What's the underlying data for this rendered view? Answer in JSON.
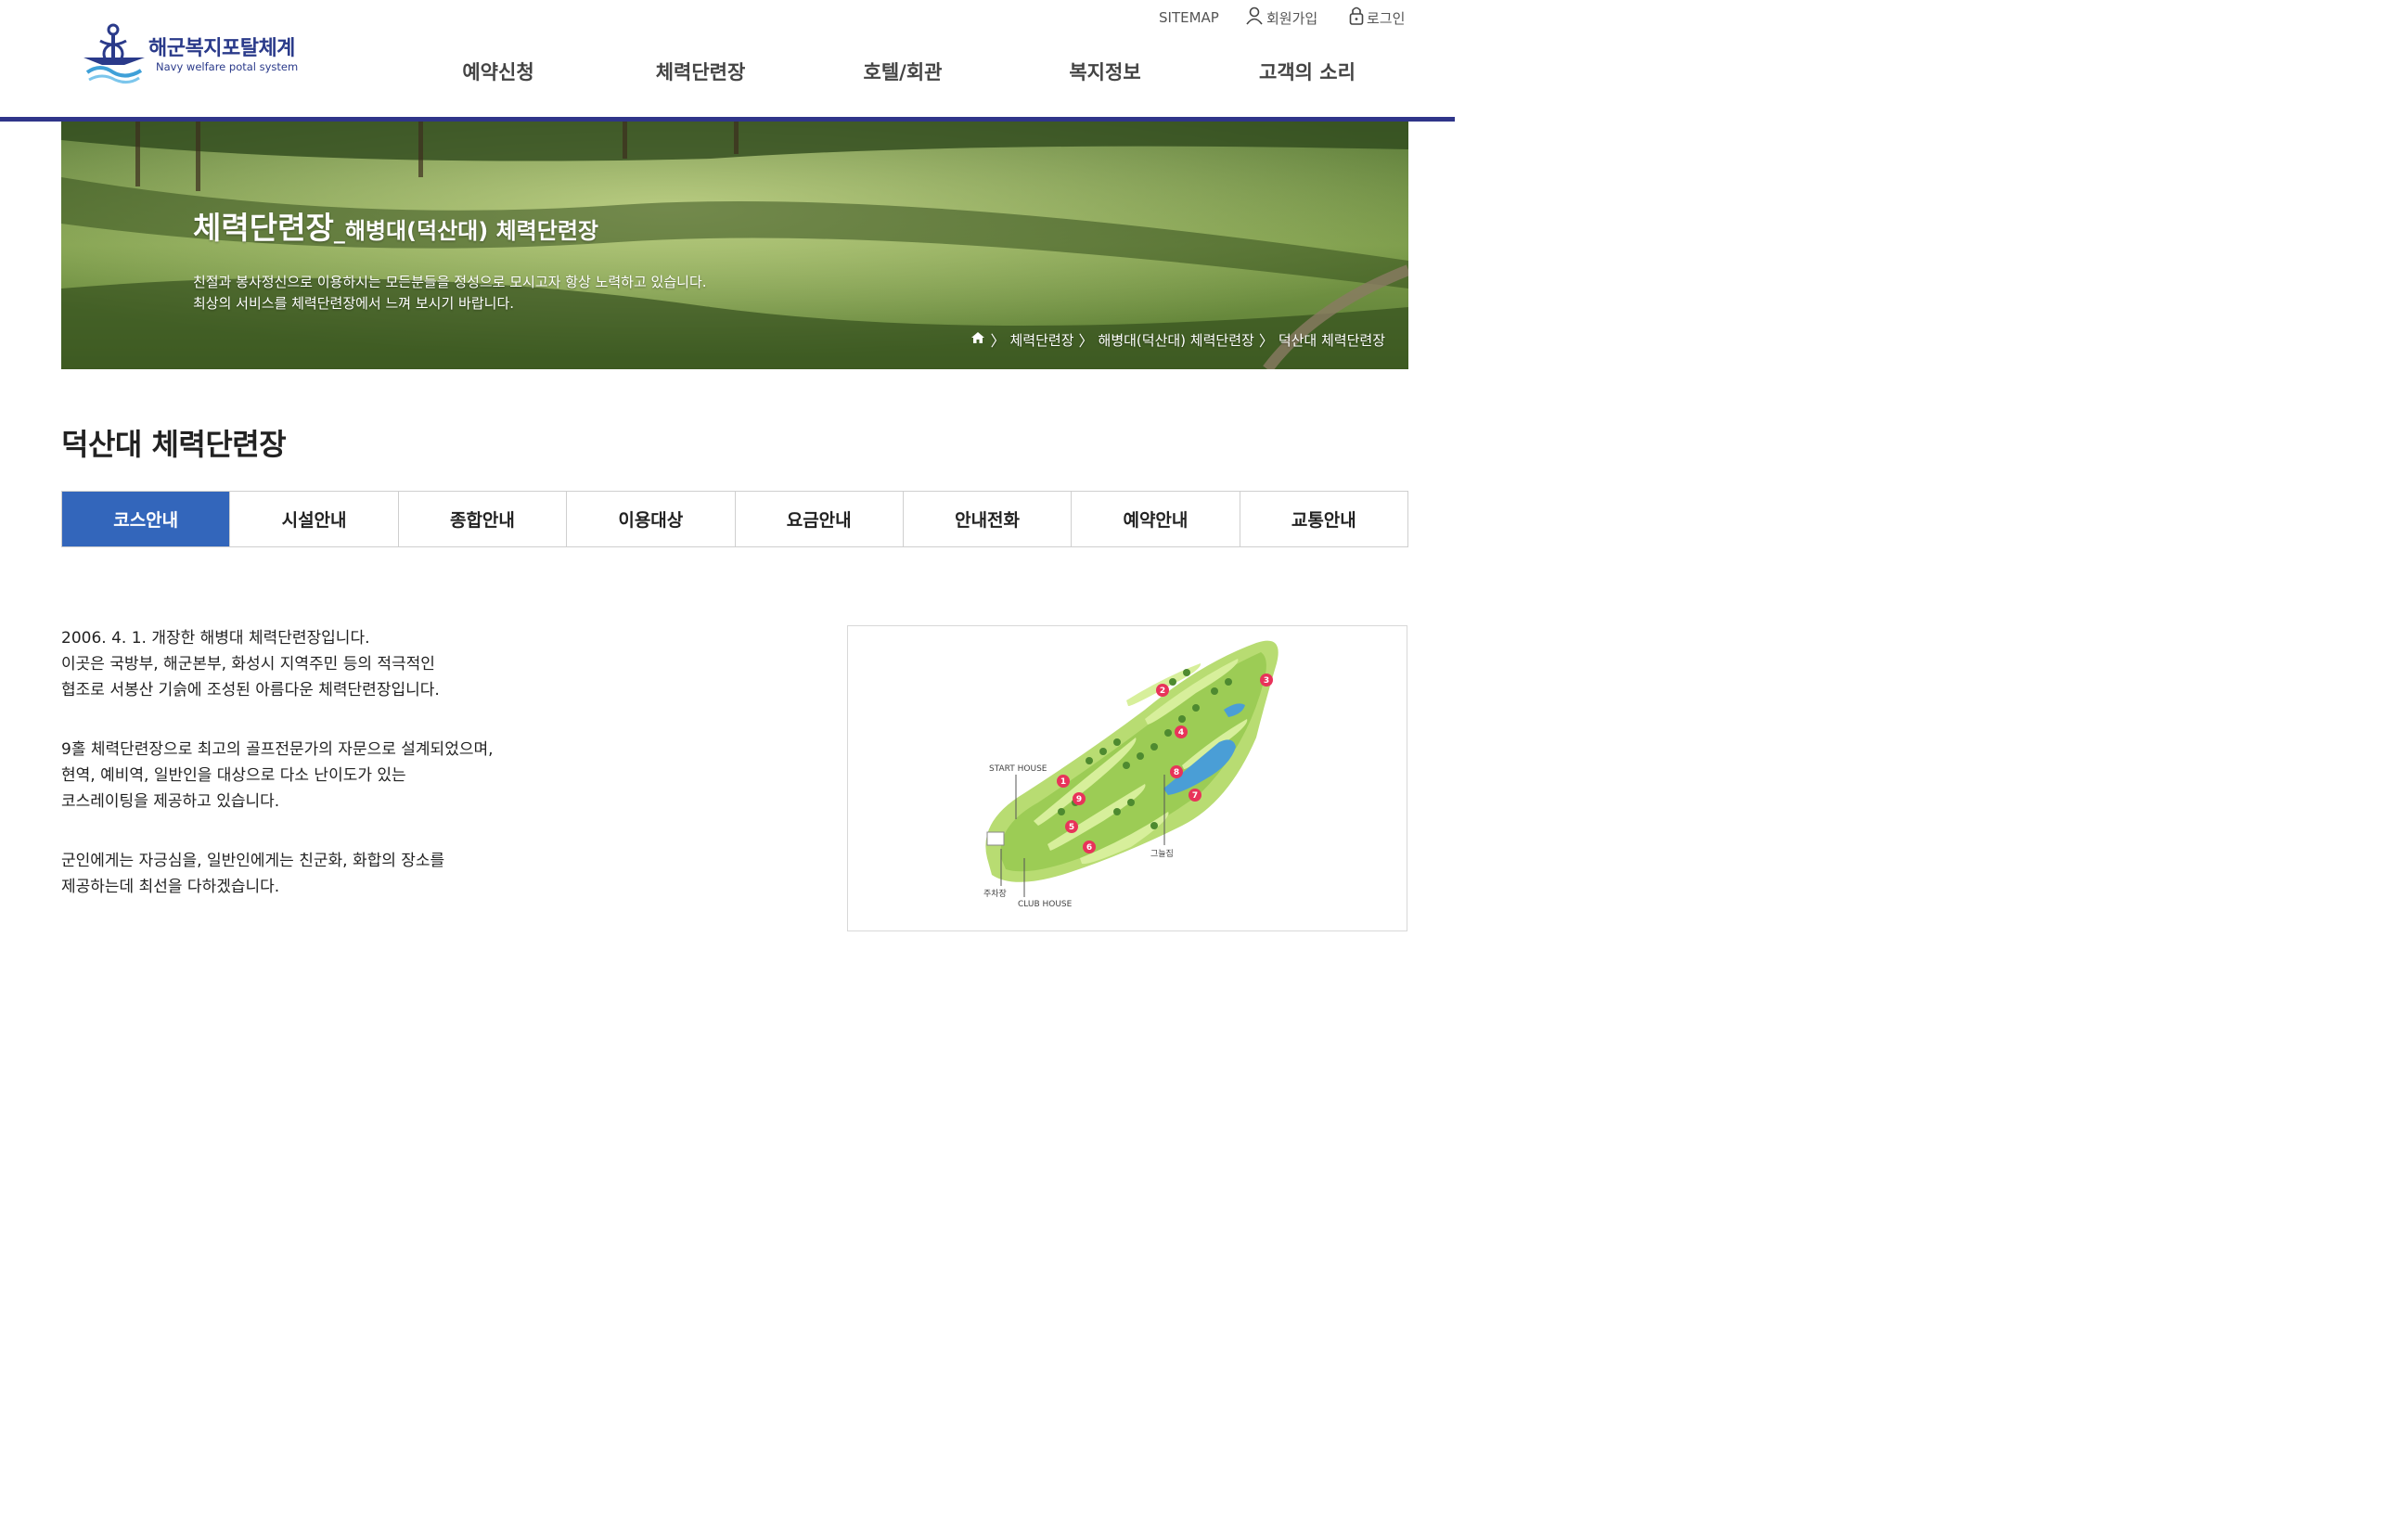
{
  "header": {
    "logo_title": "해군복지포탈체계",
    "logo_subtitle": "Navy welfare potal system",
    "util": {
      "sitemap": "SITEMAP",
      "join": "회원가입",
      "login": "로그인"
    },
    "nav": [
      "예약신청",
      "체력단련장",
      "호텔/회관",
      "복지정보",
      "고객의 소리"
    ]
  },
  "banner": {
    "title_main": "체력단련장",
    "title_sub": "_해병대(덕산대) 체력단련장",
    "desc_line1": "친절과 봉사정신으로 이용하시는 모든분들을 정성으로 모시고자 항상 노력하고 있습니다.",
    "desc_line2": "최상의 서비스를 체력단련장에서 느껴 보시기 바랍니다.",
    "breadcrumb": [
      "체력단련장",
      "해병대(덕산대) 체력단련장",
      "덕산대 체력단련장"
    ]
  },
  "page_title": "덕산대 체력단련장",
  "tabs": [
    "코스안내",
    "시설안내",
    "종합안내",
    "이용대상",
    "요금안내",
    "안내전화",
    "예약안내",
    "교통안내"
  ],
  "active_tab": "코스안내",
  "content": {
    "para1": [
      "2006. 4. 1. 개장한 해병대 체력단련장입니다.",
      "이곳은 국방부, 해군본부, 화성시 지역주민 등의 적극적인",
      "협조로 서봉산 기슭에 조성된 아름다운 체력단련장입니다."
    ],
    "para2": [
      "9홀 체력단련장으로 최고의 골프전문가의 자문으로 설계되었으며,",
      "현역, 예비역, 일반인을 대상으로 다소 난이도가 있는",
      "코스레이팅을 제공하고 있습니다."
    ],
    "para3": [
      "군인에게는 자긍심을, 일반인에게는 친군화, 화합의 장소를",
      "제공하는데 최선을 다하겠습니다."
    ]
  },
  "course_map": {
    "start_house": "START HOUSE",
    "shelter": "그늘집",
    "parking": "주차장",
    "club_house": "CLUB HOUSE",
    "holes": [
      "1",
      "2",
      "3",
      "4",
      "5",
      "6",
      "7",
      "8",
      "9"
    ]
  },
  "colors": {
    "navy": "#2f3589",
    "tab_active": "#3366bb",
    "hole_marker": "#e8335a"
  }
}
